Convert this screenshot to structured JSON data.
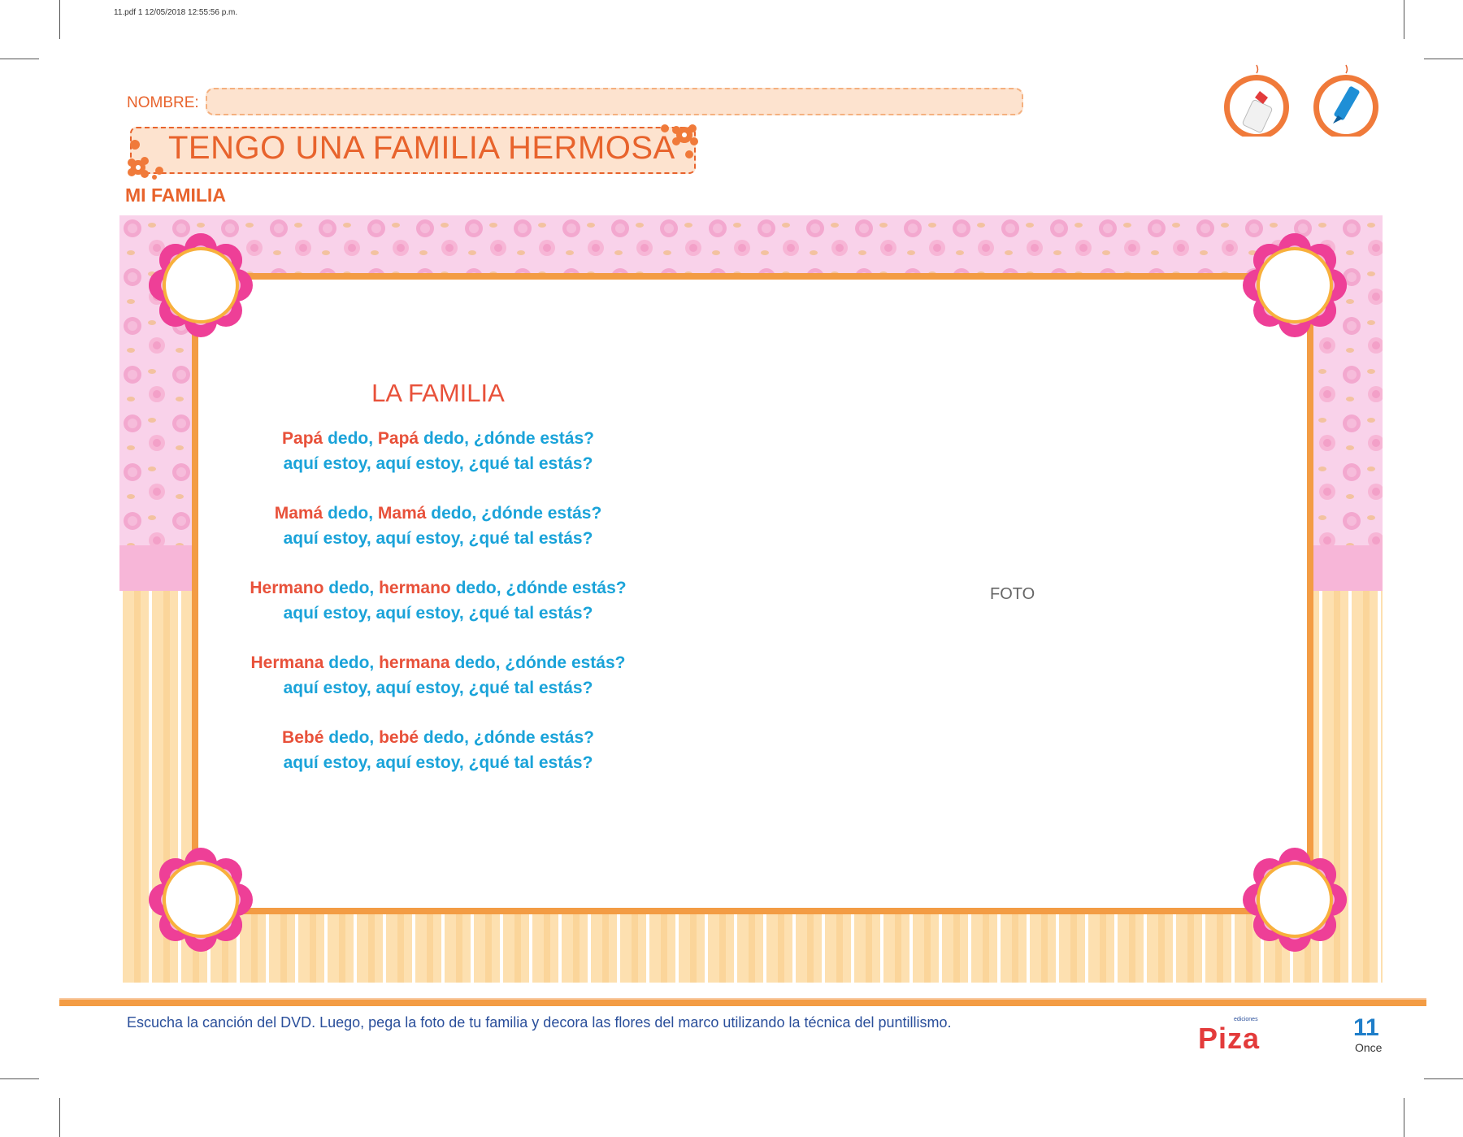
{
  "print_header": "11.pdf   1   12/05/2018   12:55:56 p.m.",
  "nombre_label": "NOMBRE:",
  "title": "TENGO UNA FAMILIA HERMOSA",
  "subtitle": "MI FAMILIA",
  "poem": {
    "title": "LA FAMILIA",
    "stanzas": [
      {
        "a_name": "Papá",
        "a_mid": " dedo, ",
        "a_name2": "Papá",
        "a_end": " dedo, ¿dónde estás?",
        "b": "aquí estoy, aquí estoy, ¿qué tal estás?"
      },
      {
        "a_name": "Mamá",
        "a_mid": " dedo, ",
        "a_name2": "Mamá",
        "a_end": " dedo, ¿dónde estás?",
        "b": "aquí estoy, aquí estoy, ¿qué tal estás?"
      },
      {
        "a_name": "Hermano",
        "a_mid": " dedo, ",
        "a_name2": "hermano",
        "a_end": " dedo, ¿dónde estás?",
        "b": "aquí estoy, aquí estoy, ¿qué tal estás?"
      },
      {
        "a_name": "Hermana",
        "a_mid": " dedo, ",
        "a_name2": "hermana",
        "a_end": " dedo, ¿dónde estás?",
        "b": "aquí estoy, aquí estoy, ¿qué tal estás?"
      },
      {
        "a_name": "Bebé",
        "a_mid": " dedo, ",
        "a_name2": "bebé",
        "a_end": " dedo, ¿dónde estás?",
        "b": "aquí estoy, aquí estoy, ¿qué tal estás?"
      }
    ]
  },
  "photo_placeholder": "FOTO",
  "instruction": "Escucha la canción del DVD. Luego, pega la foto de tu familia y decora las flores del marco utilizando la técnica del puntillismo.",
  "publisher": {
    "small": "ediciones",
    "name": "Piza"
  },
  "page_number": "11",
  "page_word": "Once",
  "icons": [
    "glue-icon",
    "marker-icon"
  ],
  "colors": {
    "orange": "#e8632c",
    "blue": "#1aa3d9",
    "pink": "#ee3f97",
    "frame_orange": "#f39c44",
    "navy": "#2a4f9b"
  }
}
